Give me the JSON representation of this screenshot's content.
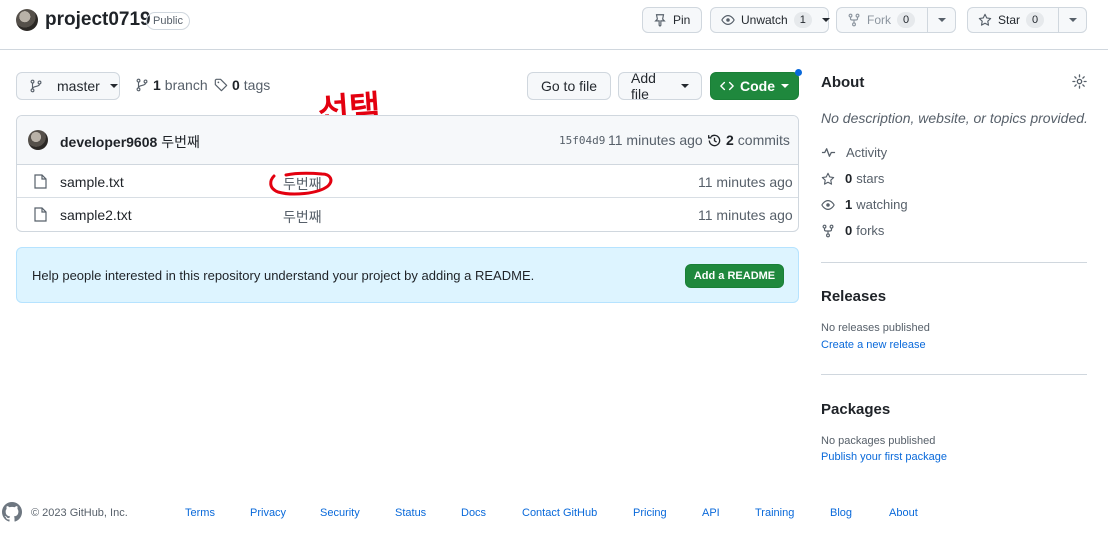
{
  "repo": {
    "name": "project0719",
    "visibility": "Public",
    "pin_label": "Pin",
    "unwatch_label": "Unwatch",
    "watch_count": "1",
    "fork_label": "Fork",
    "fork_count": "0",
    "star_label": "Star",
    "star_count": "0"
  },
  "toolbar": {
    "branch_name": "master",
    "branch_count": "1",
    "branch_word": "branch",
    "tag_count": "0",
    "tag_word": "tags",
    "go_to_file": "Go to file",
    "add_file": "Add file",
    "code": "Code"
  },
  "commit": {
    "author": "developer9608",
    "message": "두번째",
    "sha": "15f04d9",
    "time": "11 minutes ago",
    "commits_count": "2",
    "commits_word": "commits"
  },
  "files": [
    {
      "name": "sample.txt",
      "message": "두번째",
      "time": "11 minutes ago"
    },
    {
      "name": "sample2.txt",
      "message": "두번째",
      "time": "11 minutes ago"
    }
  ],
  "annotation": {
    "text": "선택",
    "color": "#e3000f"
  },
  "readme_banner": {
    "text": "Help people interested in this repository understand your project by adding a README.",
    "button": "Add a README"
  },
  "about": {
    "title": "About",
    "description": "No description, website, or topics provided.",
    "activity": "Activity",
    "stars_count": "0",
    "stars_word": "stars",
    "watching_count": "1",
    "watching_word": "watching",
    "forks_count": "0",
    "forks_word": "forks"
  },
  "releases": {
    "title": "Releases",
    "none_text": "No releases published",
    "create_link": "Create a new release"
  },
  "packages": {
    "title": "Packages",
    "none_text": "No packages published",
    "publish_link": "Publish your first package"
  },
  "footer": {
    "copyright": "© 2023 GitHub, Inc.",
    "links": [
      "Terms",
      "Privacy",
      "Security",
      "Status",
      "Docs",
      "Contact GitHub",
      "Pricing",
      "API",
      "Training",
      "Blog",
      "About"
    ]
  },
  "colors": {
    "accent_link": "#0969da",
    "primary_green": "#1f883d",
    "readme_bg": "#ddf4ff",
    "notification_dot": "#0969da"
  }
}
